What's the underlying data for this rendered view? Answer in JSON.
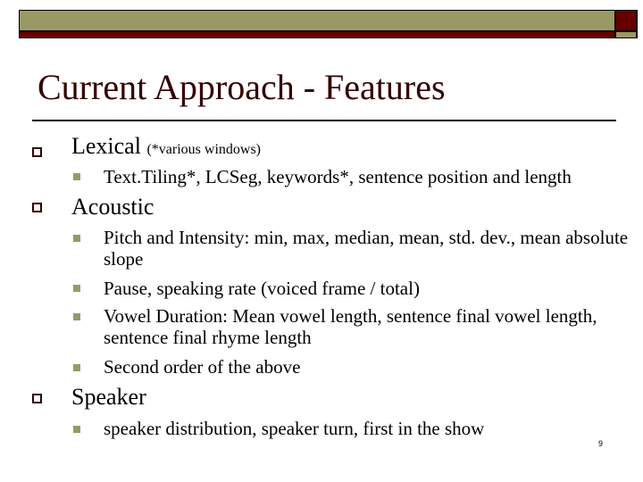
{
  "slide": {
    "title": "Current Approach - Features",
    "page_number": "9",
    "colors": {
      "olive": "#999966",
      "maroon": "#660000",
      "title": "#330000"
    },
    "sections": [
      {
        "heading": "Lexical",
        "note": "(*various windows)",
        "items": [
          "Text.Tiling*, LCSeg, keywords*, sentence position and length"
        ]
      },
      {
        "heading": "Acoustic",
        "note": "",
        "items": [
          "Pitch and Intensity: min, max, median, mean, std. dev., mean absolute slope",
          "Pause, speaking rate (voiced frame / total)",
          "Vowel Duration: Mean vowel length, sentence final vowel length, sentence final rhyme length",
          "Second order of the above"
        ]
      },
      {
        "heading": "Speaker",
        "note": "",
        "items": [
          "speaker distribution, speaker turn, first in the show"
        ]
      }
    ]
  }
}
